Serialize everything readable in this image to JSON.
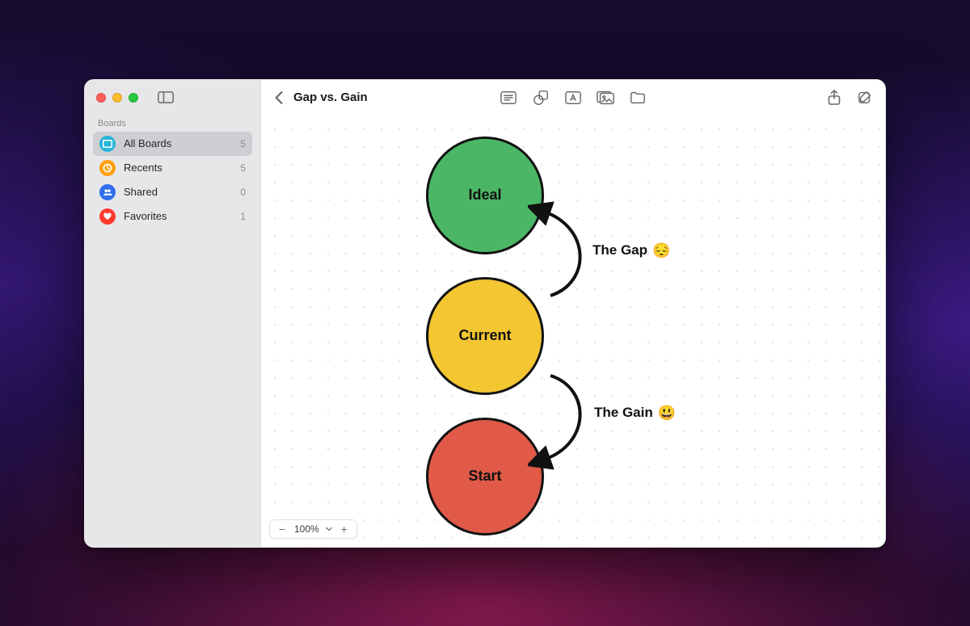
{
  "sidebar": {
    "section_label": "Boards",
    "items": [
      {
        "label": "All Boards",
        "count": "5",
        "icon": "grid",
        "color": "teal",
        "selected": true
      },
      {
        "label": "Recents",
        "count": "5",
        "icon": "clock",
        "color": "orange",
        "selected": false
      },
      {
        "label": "Shared",
        "count": "0",
        "icon": "people",
        "color": "blue",
        "selected": false
      },
      {
        "label": "Favorites",
        "count": "1",
        "icon": "heart",
        "color": "red",
        "selected": false
      }
    ]
  },
  "header": {
    "title": "Gap vs. Gain"
  },
  "canvas": {
    "nodes": {
      "ideal": {
        "label": "Ideal"
      },
      "current": {
        "label": "Current"
      },
      "start": {
        "label": "Start"
      }
    },
    "annotations": {
      "gap": {
        "text": "The Gap",
        "emoji": "😔"
      },
      "gain": {
        "text": "The Gain",
        "emoji": "😃"
      }
    }
  },
  "zoom": {
    "value": "100%"
  }
}
